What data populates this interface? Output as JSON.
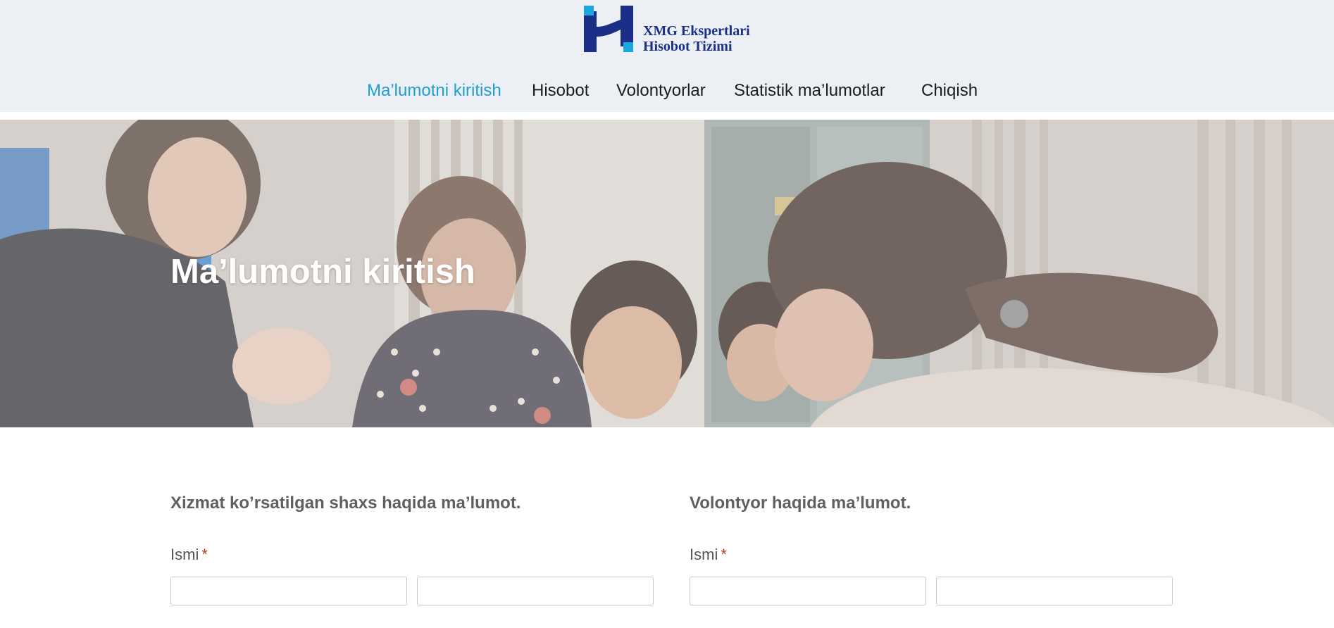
{
  "header": {
    "logo": {
      "line1": "XMG Ekspertlari",
      "line2": "Hisobot Tizimi",
      "colors": {
        "dark_blue": "#1b2f88",
        "light_blue": "#1ba8e0"
      }
    },
    "nav": [
      {
        "label": "Ma’lumotni kiritish",
        "active": true
      },
      {
        "label": "Hisobot",
        "active": false
      },
      {
        "label": "Volontyorlar",
        "active": false
      },
      {
        "label": "Statistik ma’lumotlar",
        "active": false
      },
      {
        "label": "Chiqish",
        "active": false
      }
    ],
    "active_color": "#1e9fd0"
  },
  "hero": {
    "title": "Ma’lumotni kiritish"
  },
  "form": {
    "left": {
      "title": "Xizmat ko’rsatilgan shaxs haqida ma’lumot.",
      "field_label": "Ismi",
      "required_mark": "*",
      "first_value": "",
      "second_value": ""
    },
    "right": {
      "title": "Volontyor haqida ma’lumot.",
      "field_label": "Ismi",
      "required_mark": "*",
      "first_value": "",
      "second_value": ""
    }
  }
}
